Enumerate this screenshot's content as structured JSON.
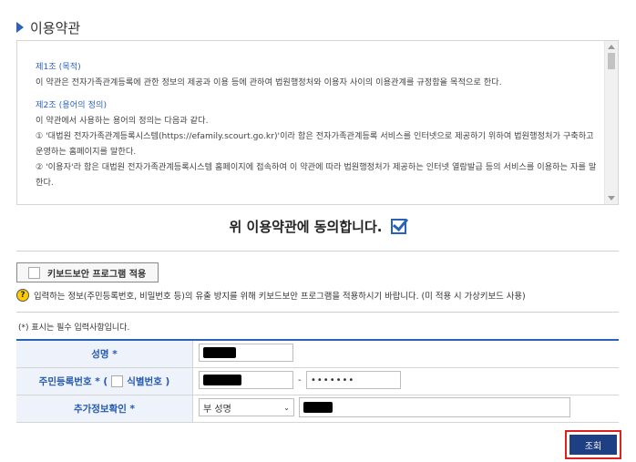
{
  "section": {
    "title": "이용약관"
  },
  "terms": {
    "article1_title": "제1조 (목적)",
    "article1_body": "이 약관은 전자가족관계등록에 관한 정보의 제공과 이용 등에 관하여 법원행정처와 이용자 사이의 이용관계를 규정함을 목적으로 한다.",
    "article2_title": "제2조 (용어의 정의)",
    "article2_intro": "이 약관에서 사용하는 용어의 정의는 다음과 같다.",
    "article2_item1": "① '대법원 전자가족관계등록시스템(https://efamily.scourt.go.kr)'이라 함은 전자가족관계등록 서비스를 인터넷으로 제공하기 위하여 법원행정처가 구축하고 운영하는 홈페이지를 말한다.",
    "article2_item2": "② '이용자'라 함은 대법원 전자가족관계등록시스템 홈페이지에 접속하여 이 약관에 따라 법원행정처가 제공하는 인터넷 열람발급 등의 서비스를 이용하는 자를 말한다."
  },
  "agree": {
    "label": "위 이용약관에 동의합니다.",
    "checked": true
  },
  "keyboard": {
    "button_label": "키보드보안 프로그램 적용"
  },
  "notice": {
    "icon": "?",
    "text": "입력하는 정보(주민등록번호, 비밀번호 등)의 유출 방지를 위해 키보드보안 프로그램을 적용하시기 바랍니다. (미 적용 시 가상키보드 사용)"
  },
  "required_note": "(*) 표시는 필수 입력사항입니다.",
  "form": {
    "name_label": "성명 *",
    "rrn_label_prefix": "주민등록번호 * (",
    "rrn_label_suffix": "식별번호 )",
    "rrn_dash": "-",
    "rrn_back_masked": "•••••••",
    "extra_label": "추가정보확인 *",
    "extra_select_value": "부 성명"
  },
  "search_button": "조회",
  "colors": {
    "accent": "#2a62b8",
    "button": "#1f3f85",
    "highlight": "#e0201a"
  }
}
